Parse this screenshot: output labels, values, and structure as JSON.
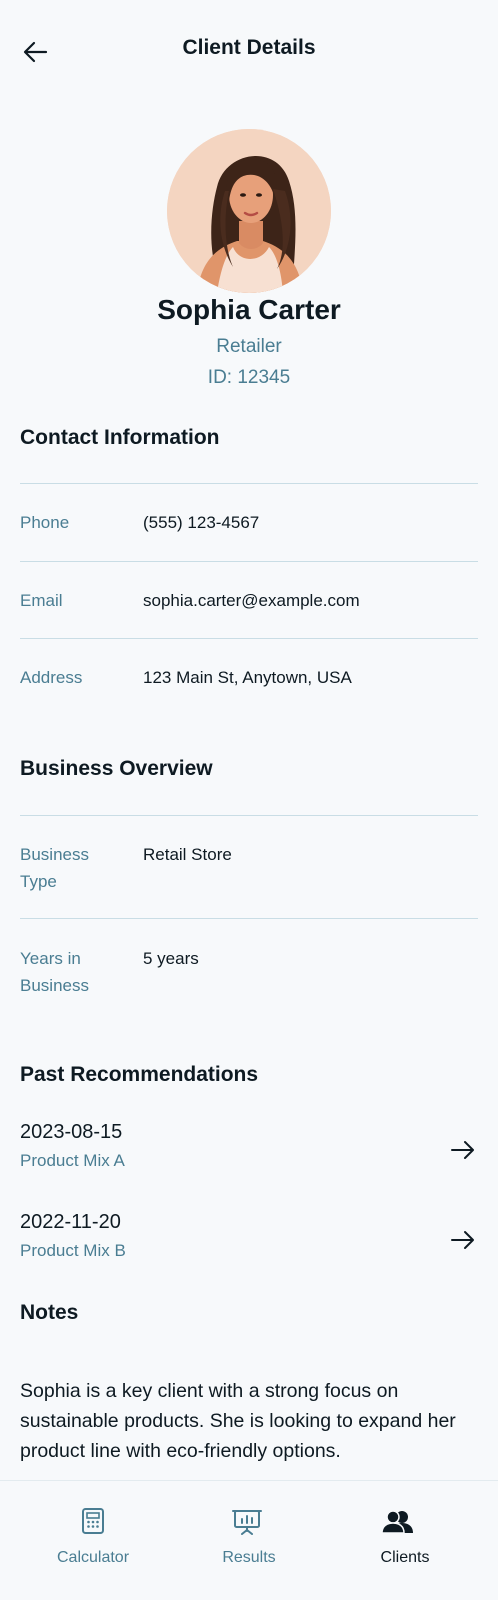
{
  "header": {
    "title": "Client Details"
  },
  "profile": {
    "name": "Sophia Carter",
    "role": "Retailer",
    "id_text": "ID: 12345"
  },
  "contact": {
    "title": "Contact Information",
    "rows": [
      {
        "label": "Phone",
        "value": "(555) 123-4567"
      },
      {
        "label": "Email",
        "value": "sophia.carter@example.com"
      },
      {
        "label": "Address",
        "value": "123 Main St, Anytown, USA"
      }
    ]
  },
  "business": {
    "title": "Business Overview",
    "rows": [
      {
        "label": "Business Type",
        "value": "Retail Store"
      },
      {
        "label": "Years in Business",
        "value": "5 years"
      }
    ]
  },
  "recommendations": {
    "title": "Past Recommendations",
    "items": [
      {
        "date": "2023-08-15",
        "product": "Product Mix A"
      },
      {
        "date": "2022-11-20",
        "product": "Product Mix B"
      }
    ]
  },
  "notes": {
    "title": "Notes",
    "text": "Sophia is a key client with a strong focus on sustainable products. She is looking to expand her product line with eco-friendly options."
  },
  "nav": {
    "items": [
      {
        "label": "Calculator",
        "icon": "calculator-icon",
        "active": false
      },
      {
        "label": "Results",
        "icon": "presentation-chart-icon",
        "active": false
      },
      {
        "label": "Clients",
        "icon": "users-icon",
        "active": true
      }
    ]
  },
  "colors": {
    "accent": "#4a7d92",
    "text": "#0e1a22",
    "divider": "#c9dde5",
    "background": "#f7f9fb"
  }
}
